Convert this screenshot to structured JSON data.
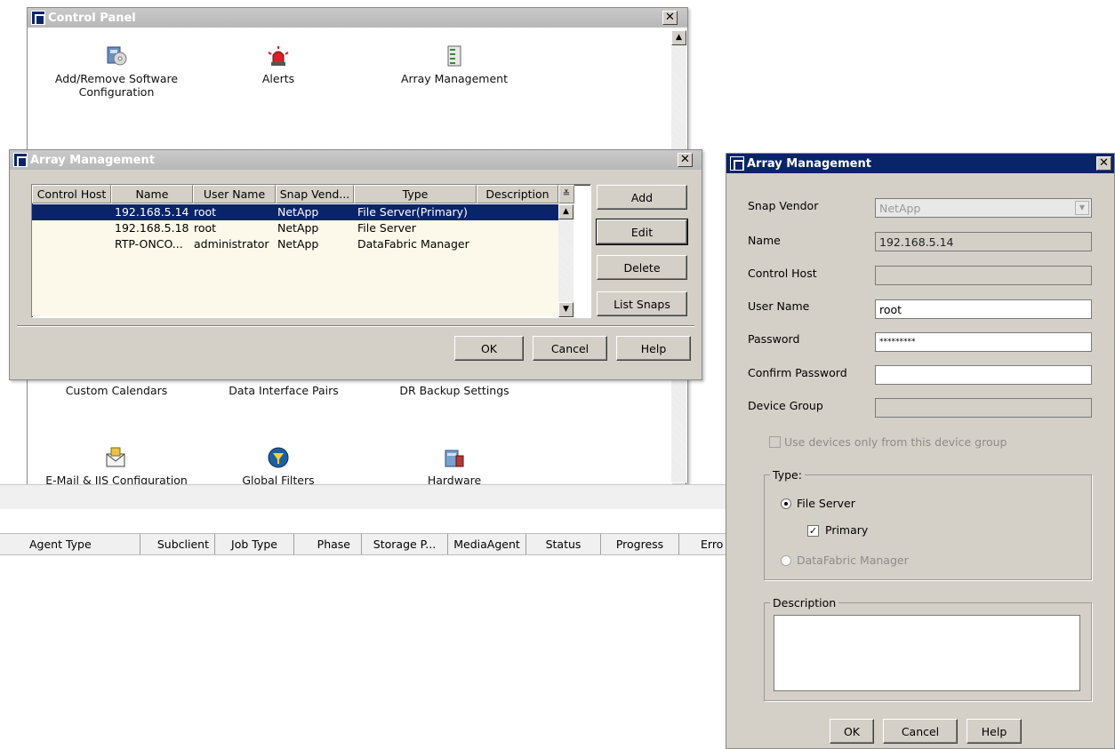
{
  "control_panel": {
    "title": "Control Panel",
    "icons_row1": [
      {
        "label_line1": "Add/Remove Software",
        "label_line2": "Configuration",
        "icon": "software-install-icon"
      },
      {
        "label_line1": "Alerts",
        "label_line2": "",
        "icon": "alarm-siren-icon"
      },
      {
        "label_line1": "Array Management",
        "label_line2": "",
        "icon": "storage-array-icon"
      }
    ],
    "icons_row2": [
      {
        "label": "Custom Calendars"
      },
      {
        "label": "Data Interface Pairs"
      },
      {
        "label": "DR Backup Settings"
      }
    ],
    "icons_row3": [
      {
        "label": "E-Mail & IIS Configuration",
        "icon": "email-config-icon"
      },
      {
        "label": "Global Filters",
        "icon": "filter-icon"
      },
      {
        "label": "Hardware Maintenance",
        "icon": "hardware-maintenance-icon"
      }
    ]
  },
  "array_list_window": {
    "title": "Array Management",
    "columns": [
      "Control Host",
      "Name",
      "User Name",
      "Snap Vend...",
      "Type",
      "Description"
    ],
    "rows": [
      {
        "control_host": "",
        "name": "192.168.5.14",
        "user": "root",
        "vendor": "NetApp",
        "type": "File Server(Primary)",
        "description": "",
        "selected": true
      },
      {
        "control_host": "",
        "name": "192.168.5.18",
        "user": "root",
        "vendor": "NetApp",
        "type": "File Server",
        "description": "",
        "selected": false
      },
      {
        "control_host": "",
        "name": "RTP-ONCO...",
        "user": "administrator",
        "vendor": "NetApp",
        "type": "DataFabric Manager",
        "description": "",
        "selected": false
      }
    ],
    "side_buttons": [
      "Add",
      "Edit",
      "Delete",
      "List Snaps"
    ],
    "bottom_buttons": [
      "OK",
      "Cancel",
      "Help"
    ]
  },
  "job_controller": {
    "columns": [
      "Agent Type",
      "Subclient",
      "Job Type",
      "Phase",
      "Storage P...",
      "MediaAgent",
      "Status",
      "Progress",
      "Erro"
    ]
  },
  "array_detail_dialog": {
    "title": "Array Management",
    "fields": {
      "snap_vendor_label": "Snap Vendor",
      "snap_vendor_value": "NetApp",
      "name_label": "Name",
      "name_value": "192.168.5.14",
      "control_host_label": "Control Host",
      "control_host_value": "",
      "user_name_label": "User Name",
      "user_name_value": "root",
      "password_label": "Password",
      "password_value": "*********",
      "confirm_password_label": "Confirm Password",
      "confirm_password_value": "",
      "device_group_label": "Device Group",
      "device_group_value": ""
    },
    "use_devices_checkbox": {
      "label": "Use devices only from this device group",
      "checked": false,
      "enabled": false
    },
    "type_group": {
      "title": "Type:",
      "file_server_label": "File Server",
      "file_server_selected": true,
      "primary_label": "Primary",
      "primary_checked": true,
      "datafabric_label": "DataFabric Manager",
      "datafabric_selected": false
    },
    "description_group": {
      "title": "Description",
      "value": ""
    },
    "buttons": [
      "OK",
      "Cancel",
      "Help"
    ]
  }
}
